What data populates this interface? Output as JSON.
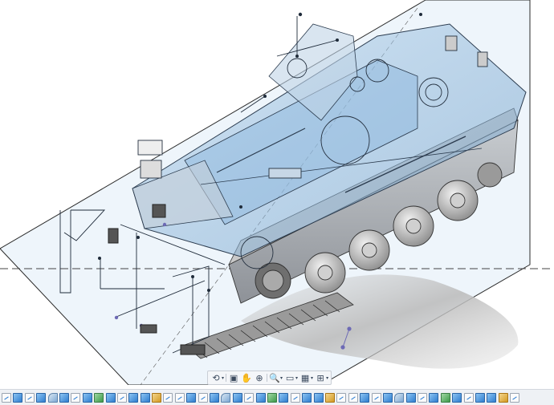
{
  "app": {
    "view": "3D model viewport",
    "subject": "tracked armored vehicle assembly (transparent hull, sketch geometry visible)"
  },
  "colors": {
    "background": "#ffffff",
    "sketch_plane": "#eaf3fb",
    "hull_transparent": "#8fb9dc",
    "running_gear": "#9a9a9a",
    "sketch_lines": "#1f2b3a"
  },
  "nav_toolbar": {
    "tools": [
      {
        "icon": "orbit-icon",
        "glyph": "⟲",
        "has_dropdown": true
      },
      {
        "icon": "look-at-icon",
        "glyph": "▣",
        "has_dropdown": false
      },
      {
        "icon": "pan-icon",
        "glyph": "✋",
        "has_dropdown": false
      },
      {
        "icon": "zoom-window-icon",
        "glyph": "⊕",
        "has_dropdown": false
      },
      {
        "icon": "zoom-icon",
        "glyph": "🔍",
        "has_dropdown": true
      },
      {
        "icon": "display-settings-icon",
        "glyph": "▭",
        "has_dropdown": true
      },
      {
        "icon": "grid-icon",
        "glyph": "▦",
        "has_dropdown": true
      },
      {
        "icon": "viewports-icon",
        "glyph": "⊞",
        "has_dropdown": true
      }
    ]
  },
  "timeline": {
    "feature_count": 45,
    "pattern": [
      "sketch",
      "extrude",
      "sketch",
      "extrude",
      "fillet",
      "extrude",
      "sketch",
      "extrude",
      "shell",
      "extrude",
      "sketch",
      "extrude",
      "extrude",
      "pattern",
      "sketch"
    ]
  }
}
